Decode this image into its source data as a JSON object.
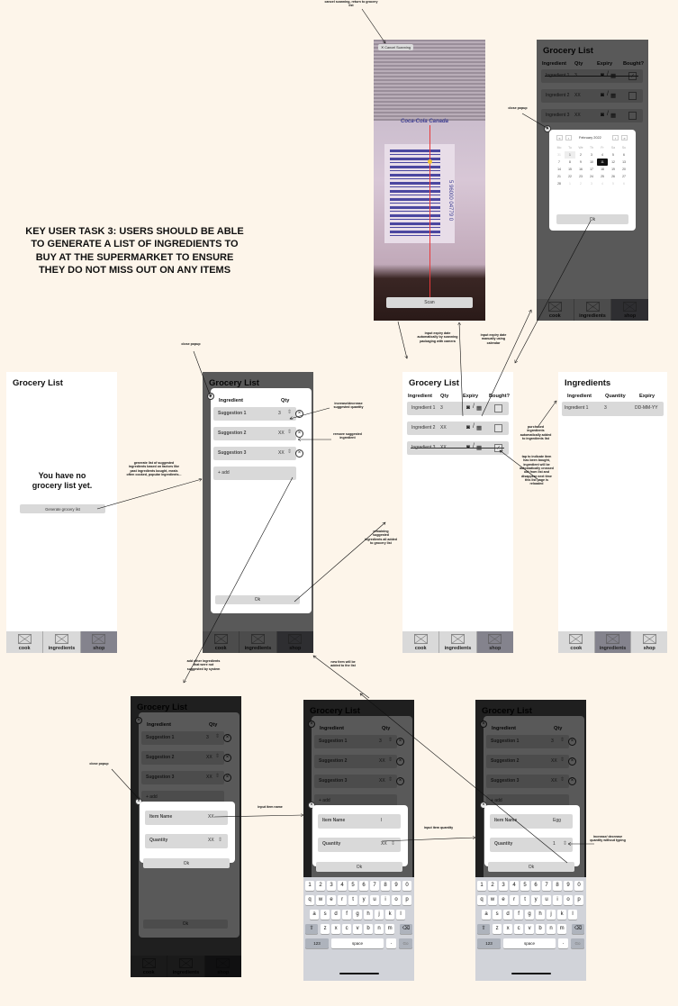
{
  "title": "KEY USER TASK 3: USERS SHOULD BE ABLE TO GENERATE A LIST OF INGREDIENTS TO BUY AT THE SUPERMARKET TO ENSURE THEY DO NOT MISS OUT ON ANY ITEMS",
  "nav_tabs": [
    "cook",
    "ingredients",
    "shop"
  ],
  "scanner_screen": {
    "cancel_label": "Cancel Scanning",
    "scan_button": "Scan",
    "barcode_digits": "5 96000 04779 0",
    "packaging_brand": "Coca-Cola Canada"
  },
  "calendar_screen": {
    "title": "Grocery List",
    "headers": [
      "Ingredient",
      "Qty",
      "Expiry",
      "Bought?"
    ],
    "rows": [
      {
        "name": "Ingredient 1",
        "qty": "3",
        "bought": true
      },
      {
        "name": "Ingredient 2",
        "qty": "XX",
        "bought": false
      },
      {
        "name": "Ingredient 3",
        "qty": "XX",
        "bought": false
      }
    ],
    "calendar": {
      "month": "February 2022",
      "nav": [
        "«",
        "‹",
        "›",
        "»"
      ],
      "weekdays": [
        "Mo",
        "Tu",
        "We",
        "Th",
        "Fr",
        "Sa",
        "Su"
      ],
      "weeks": [
        [
          "31",
          "1",
          "2",
          "3",
          "4",
          "5",
          "6"
        ],
        [
          "7",
          "8",
          "9",
          "10",
          "11",
          "12",
          "13"
        ],
        [
          "14",
          "15",
          "16",
          "17",
          "18",
          "19",
          "20"
        ],
        [
          "21",
          "22",
          "23",
          "24",
          "25",
          "26",
          "27"
        ],
        [
          "28",
          "1",
          "2",
          "3",
          "4",
          "5",
          "6"
        ]
      ],
      "selected": "11",
      "ok": "Ok"
    }
  },
  "empty_screen": {
    "title": "Grocery List",
    "empty_message": "You have no grocery list yet.",
    "generate_button": "Generate grocery list"
  },
  "suggestions_screen": {
    "title": "Grocery List",
    "headers": [
      "Ingredient",
      "Qty"
    ],
    "rows": [
      {
        "name": "Suggestion 1",
        "qty": "3"
      },
      {
        "name": "Suggestion 2",
        "qty": "XX"
      },
      {
        "name": "Suggestion 3",
        "qty": "XX"
      }
    ],
    "add_label": "+ add",
    "ok": "Ok"
  },
  "grocery_screen": {
    "title": "Grocery List",
    "headers": [
      "Ingredient",
      "Qty",
      "Expiry",
      "Bought?"
    ],
    "rows": [
      {
        "name": "Ingredient 1",
        "qty": "3",
        "bought": false
      },
      {
        "name": "Ingredient 2",
        "qty": "XX",
        "bought": false
      },
      {
        "name": "Ingredient 3",
        "qty": "XX",
        "bought": true
      }
    ]
  },
  "ingredients_screen": {
    "title": "Ingredients",
    "headers": [
      "Ingredient",
      "Quantity",
      "Expiry"
    ],
    "rows": [
      {
        "name": "Ingredient 1",
        "qty": "3",
        "expiry": "DD-MM-YY"
      }
    ]
  },
  "add_item_screens": [
    {
      "item_name_label": "Item Name",
      "item_name_value": "XX",
      "quantity_label": "Quantity",
      "quantity_value": "XX",
      "ok": "Ok"
    },
    {
      "item_name_label": "Item Name",
      "item_name_value": "I",
      "quantity_label": "Quantity",
      "quantity_value": "XX",
      "ok": "Ok"
    },
    {
      "item_name_label": "Item Name",
      "item_name_value": "Egg",
      "quantity_label": "Quantity",
      "quantity_value": "1",
      "ok": "Ok"
    }
  ],
  "keyboard": {
    "rows": [
      [
        "1",
        "2",
        "3",
        "4",
        "5",
        "6",
        "7",
        "8",
        "9",
        "0"
      ],
      [
        "q",
        "w",
        "e",
        "r",
        "t",
        "y",
        "u",
        "i",
        "o",
        "p"
      ],
      [
        "a",
        "s",
        "d",
        "f",
        "g",
        "h",
        "j",
        "k",
        "l"
      ],
      [
        "z",
        "x",
        "c",
        "v",
        "b",
        "n",
        "m"
      ]
    ],
    "num_key": "123",
    "space": "space",
    "period": ".",
    "go": "Go"
  },
  "annotations": {
    "cancel_scan": "cancel scanning, return to grocery list",
    "close_popup_calendar": "close popup",
    "scan_expiry": "input expiry date automatically by scanning packaging with camera",
    "manual_expiry": "input expiry date manually using calendar",
    "close_popup_suggestions": "close popup",
    "adjust_qty": "increase/decrease suggested quantity",
    "remove_suggestion": "remove suggested ingredient",
    "generate_list": "generate list of suggested ingredients based on factors like past ingredients bought, meals often cooked, popular ingredients...",
    "purchased_added": "purchased ingredients automatically added to ingredients list",
    "tap_bought": "tap to indicate item has been bought, ingredient will be automatically crossed out from list and disappear next time this list page is reloaded",
    "remaining_added": "remaining suggested ingredients all added to grocery list",
    "add_other": "add other ingredients that were not suggested by system",
    "new_item": "new item will be added to the list",
    "close_popup_add": "close popup",
    "input_name": "input item name",
    "input_qty": "input item quantity",
    "qty_stepper": "increase/ decrease quantity without typing"
  }
}
